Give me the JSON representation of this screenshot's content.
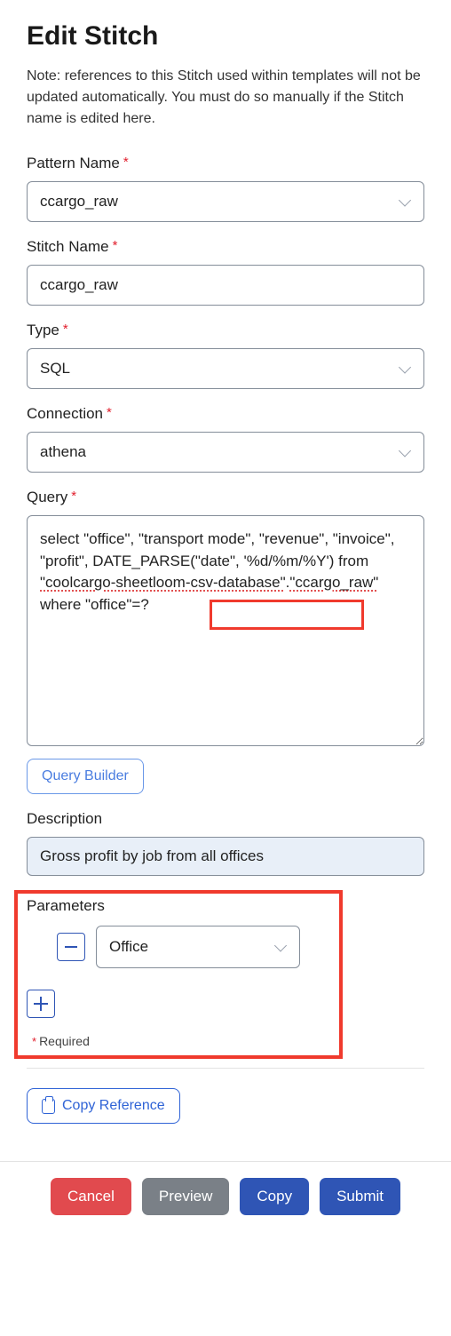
{
  "title": "Edit Stitch",
  "note": "Note: references to this Stitch used within templates will not be updated automatically. You must do so manually if the Stitch name is edited here.",
  "labels": {
    "pattern_name": "Pattern Name",
    "stitch_name": "Stitch Name",
    "type": "Type",
    "connection": "Connection",
    "query": "Query",
    "description": "Description",
    "parameters": "Parameters",
    "required": "Required"
  },
  "values": {
    "pattern_name": "ccargo_raw",
    "stitch_name": "ccargo_raw",
    "type": "SQL",
    "connection": "athena",
    "query_plain": "select \"office\", \"transport mode\", \"revenue\", \"invoice\", \"profit\", DATE_PARSE(\"date\", '%d/%m/%Y') from \"coolcargo-sheetloom-csv-database\".\"ccargo_raw\" where \"office\"=?",
    "description": "Gross profit by job from all offices",
    "parameter_0": "Office"
  },
  "buttons": {
    "query_builder": "Query Builder",
    "copy_reference": "Copy Reference",
    "cancel": "Cancel",
    "preview": "Preview",
    "copy": "Copy",
    "submit": "Submit"
  }
}
